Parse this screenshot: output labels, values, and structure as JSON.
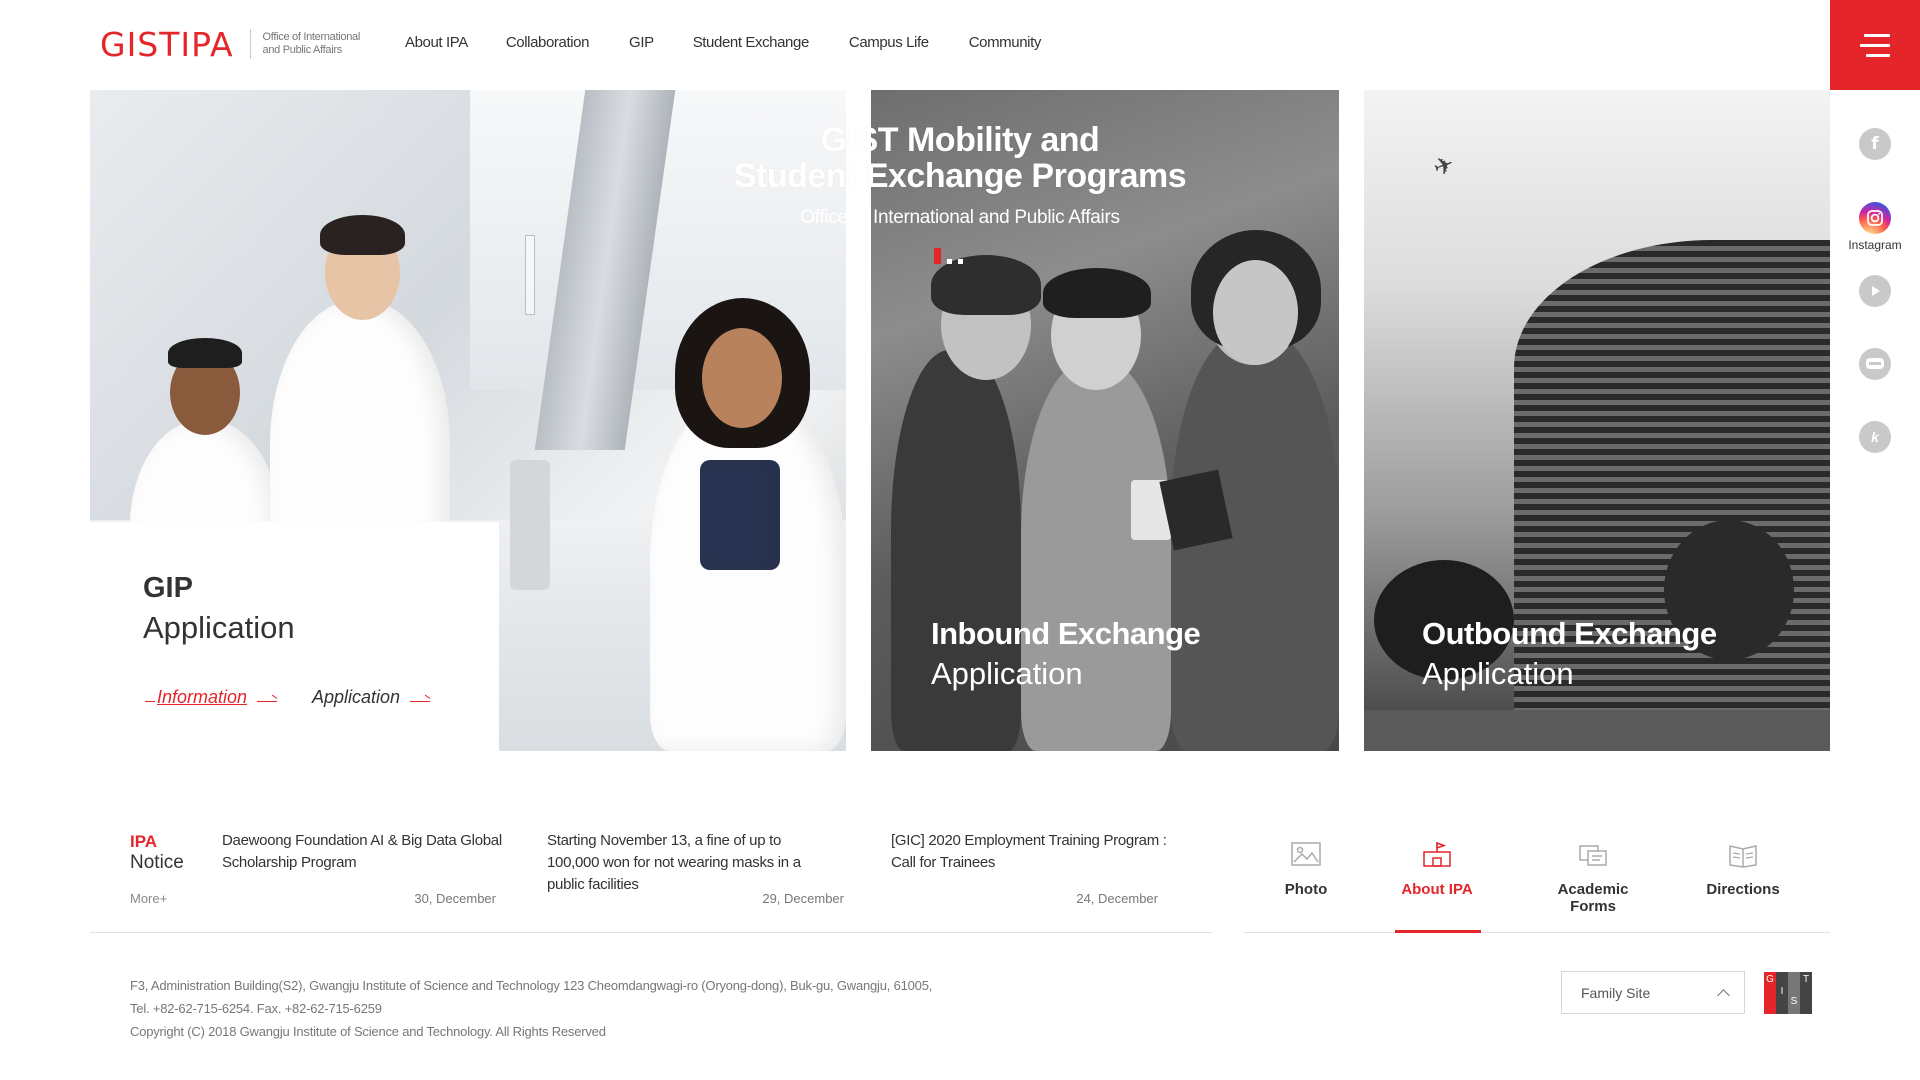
{
  "header": {
    "logo_gist": "GIST",
    "logo_ipa": "IPA",
    "logo_sub_line1": "Office of International",
    "logo_sub_line2": "and Public Affairs",
    "nav": [
      "About IPA",
      "Collaboration",
      "GIP",
      "Student Exchange",
      "Campus Life",
      "Community"
    ]
  },
  "social": {
    "items": [
      {
        "icon": "facebook-icon",
        "label": ""
      },
      {
        "icon": "instagram-icon",
        "label": "Instagram"
      },
      {
        "icon": "youtube-icon",
        "label": ""
      },
      {
        "icon": "blog-icon",
        "label": ""
      },
      {
        "icon": "kakao-icon",
        "label": ""
      }
    ]
  },
  "hero": {
    "title_line1": "GIST Mobility and",
    "title_line2": "Student Exchange Programs",
    "subtitle": "Office of International and Public Affairs",
    "slide_count": 3,
    "active_slide": 1
  },
  "gip": {
    "title": "GIP",
    "subtitle": "Application",
    "link_info": "Information",
    "link_apply": "Application"
  },
  "inbound": {
    "title": "Inbound Exchange",
    "subtitle": "Application"
  },
  "outbound": {
    "title": "Outbound Exchange",
    "subtitle": "Application"
  },
  "notice": {
    "label_ipa": "IPA",
    "label_notice": "Notice",
    "more": "More+",
    "items": [
      {
        "title": "Daewoong Foundation AI & Big Data Global Scholarship Program",
        "date": "30, December"
      },
      {
        "title": "Starting November 13, a fine of up to 100,000 won for not wearing masks in a public facilities",
        "date": "29, December"
      },
      {
        "title": "[GIC] 2020 Employment Training Program : Call for Trainees",
        "date": "24, December"
      }
    ]
  },
  "quicklinks": [
    {
      "label": "Photo",
      "icon": "photo-icon"
    },
    {
      "label": "About IPA",
      "icon": "about-icon",
      "active": true
    },
    {
      "label": "Academic Forms",
      "icon": "forms-icon"
    },
    {
      "label": "Directions",
      "icon": "directions-icon"
    }
  ],
  "footer": {
    "address": "F3, Administration Building(S2), Gwangju Institute of Science and Technology 123 Cheomdangwagi-ro (Oryong-dong), Buk-gu, Gwangju, 61005,",
    "contact": "Tel. +82-62-715-6254. Fax. +82-62-715-6259",
    "copyright": "Copyright (C) 2018 Gwangju Institute of Science and Technology. All Rights Reserved",
    "family_site": "Family Site",
    "gist_letters": [
      "G",
      "I",
      "S",
      "T"
    ]
  },
  "colors": {
    "accent": "#e4252a",
    "text": "#333333"
  }
}
